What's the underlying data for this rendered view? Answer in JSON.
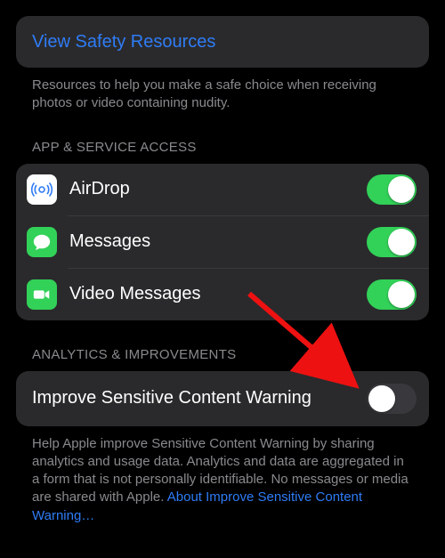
{
  "resources": {
    "link_label": "View Safety Resources",
    "footer": "Resources to help you make a safe choice when receiving photos or video containing nudity."
  },
  "access": {
    "header": "APP & SERVICE ACCESS",
    "items": [
      {
        "icon": "airdrop-icon",
        "label": "AirDrop",
        "on": true
      },
      {
        "icon": "messages-icon",
        "label": "Messages",
        "on": true
      },
      {
        "icon": "video-messages-icon",
        "label": "Video Messages",
        "on": true
      }
    ]
  },
  "analytics": {
    "header": "ANALYTICS & IMPROVEMENTS",
    "row_label": "Improve Sensitive Content Warning",
    "on": false,
    "footer_prefix": "Help Apple improve Sensitive Content Warning by sharing analytics and usage data. Analytics and data are aggregated in a form that is not personally identifiable. No messages or media are shared with Apple. ",
    "footer_link": "About Improve Sensitive Content Warning…"
  }
}
